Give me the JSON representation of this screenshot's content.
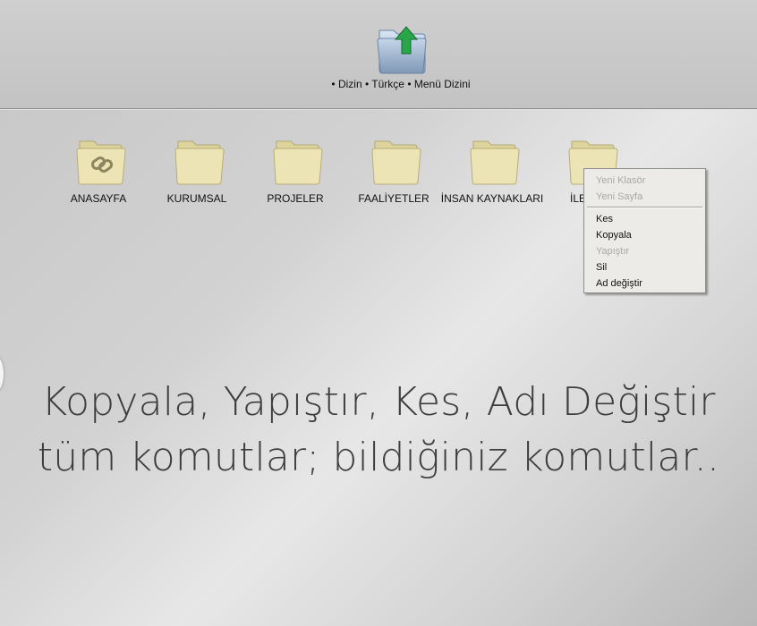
{
  "header": {
    "up_folder_icon": "folder-up-arrow-icon",
    "breadcrumb": {
      "items": [
        "• Dizin",
        "• Türkçe",
        "• Menü Dizini"
      ]
    }
  },
  "folders": [
    {
      "label": "ANASAYFA",
      "icon": "folder-link-icon"
    },
    {
      "label": "KURUMSAL",
      "icon": "folder-icon"
    },
    {
      "label": "PROJELER",
      "icon": "folder-icon"
    },
    {
      "label": "FAALİYETLER",
      "icon": "folder-icon"
    },
    {
      "label": "İNSAN KAYNAKLARI",
      "icon": "folder-icon"
    },
    {
      "label": "İLE",
      "icon": "folder-icon"
    }
  ],
  "context_menu": {
    "items": [
      {
        "label": "Yeni Klasör",
        "enabled": false
      },
      {
        "label": "Yeni Sayfa",
        "enabled": false
      },
      {
        "label": "Kes",
        "enabled": true
      },
      {
        "label": "Kopyala",
        "enabled": true
      },
      {
        "label": "Yapıştır",
        "enabled": false
      },
      {
        "label": "Sil",
        "enabled": true
      },
      {
        "label": "Ad değiştir",
        "enabled": true
      }
    ]
  },
  "tagline": {
    "line1": "Kopyala, Yapıştır, Kes, Adı Değiştir",
    "line2": "tüm komutlar; bildiğiniz komutlar.."
  },
  "colors": {
    "folder_fill": "#ece4b4",
    "folder_stroke": "#b8ad78",
    "up_folder_fill": "#a9bfd8",
    "up_arrow": "#2aa64a",
    "menu_bg": "#ecebe8",
    "tagline": "#3d3d3d"
  }
}
